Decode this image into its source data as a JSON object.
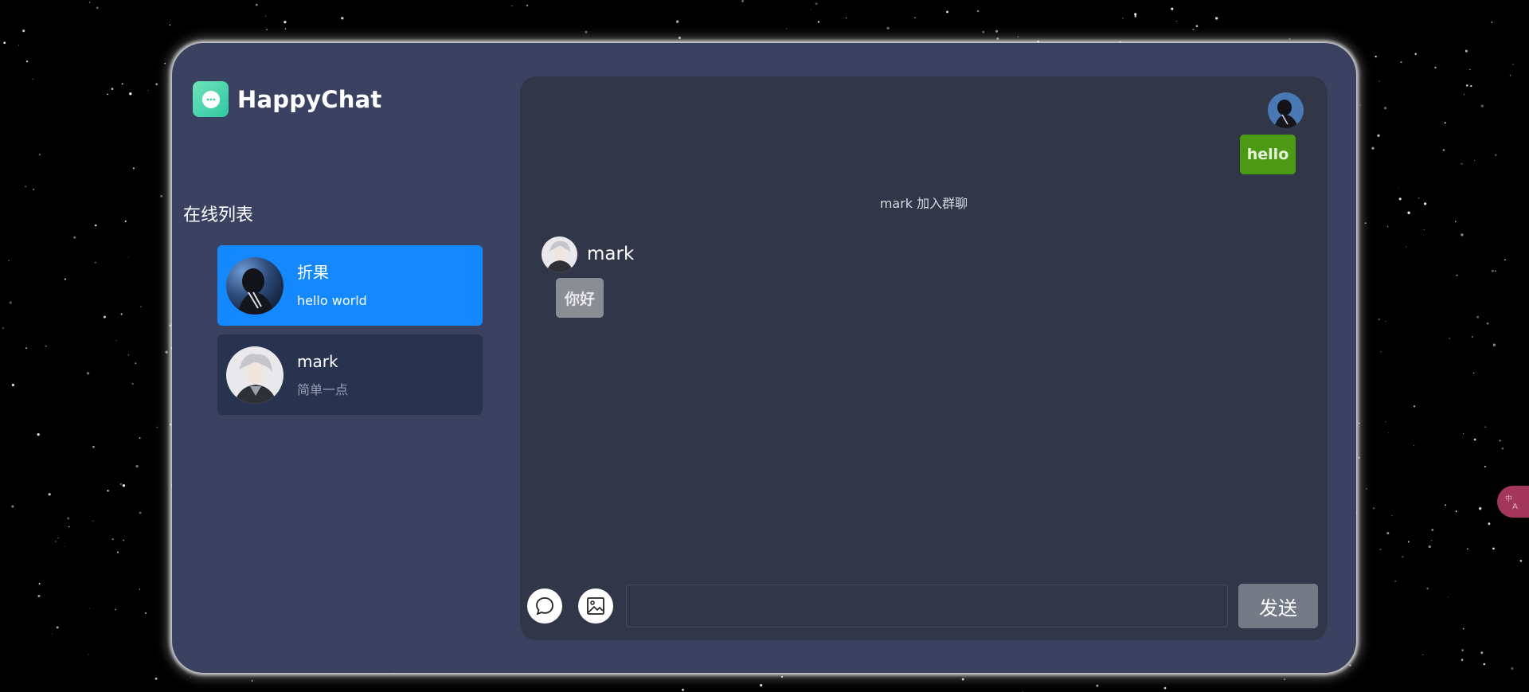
{
  "app": {
    "name": "HappyChat"
  },
  "sidebar": {
    "title": "在线列表",
    "contacts": [
      {
        "name": "折果",
        "message": "hello world",
        "active": true
      },
      {
        "name": "mark",
        "message": "简单一点",
        "active": false
      }
    ]
  },
  "chat": {
    "messages": [
      {
        "type": "self",
        "text": "hello"
      },
      {
        "type": "system",
        "text": "mark 加入群聊"
      },
      {
        "type": "other",
        "sender": "mark",
        "text": "你好"
      }
    ],
    "input": {
      "value": "",
      "placeholder": ""
    },
    "send_label": "发送"
  },
  "icons": {
    "logo": "chat-bubble-icon",
    "emoji": "chat-bubble-outline-icon",
    "image": "image-icon",
    "translate": "translate-icon"
  },
  "colors": {
    "app_bg": "#3b4261",
    "chat_bg": "#313748",
    "active_contact": "#1489ff",
    "idle_contact": "#283350",
    "self_bubble": "#4c9a14",
    "other_bubble": "#8a8d92",
    "send_button": "#737a86",
    "logo_gradient_start": "#6fe3b9",
    "logo_gradient_end": "#2fc8a3"
  }
}
